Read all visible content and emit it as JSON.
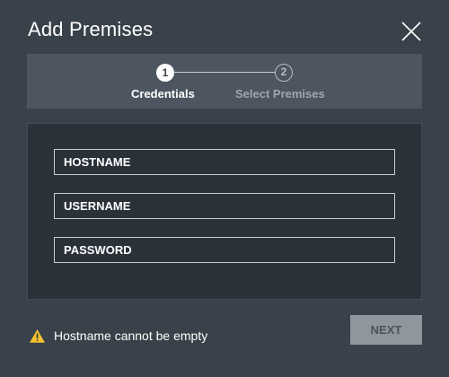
{
  "dialog": {
    "title": "Add Premises",
    "close_icon": "close-icon"
  },
  "stepper": {
    "steps": [
      {
        "number": "1",
        "label": "Credentials",
        "state": "active"
      },
      {
        "number": "2",
        "label": "Select Premises",
        "state": "inactive"
      }
    ]
  },
  "form": {
    "hostname": {
      "placeholder": "HOSTNAME",
      "value": ""
    },
    "username": {
      "placeholder": "USERNAME",
      "value": ""
    },
    "password": {
      "placeholder": "PASSWORD",
      "value": ""
    }
  },
  "validation": {
    "icon": "warning-icon",
    "message": "Hostname cannot be empty"
  },
  "footer": {
    "next_label": "NEXT",
    "next_enabled": false
  },
  "colors": {
    "background": "#39424a",
    "stepper_bg": "#4c5560",
    "panel_bg": "#2b3139",
    "warning": "#f2c230",
    "button_disabled": "#8f969d"
  }
}
